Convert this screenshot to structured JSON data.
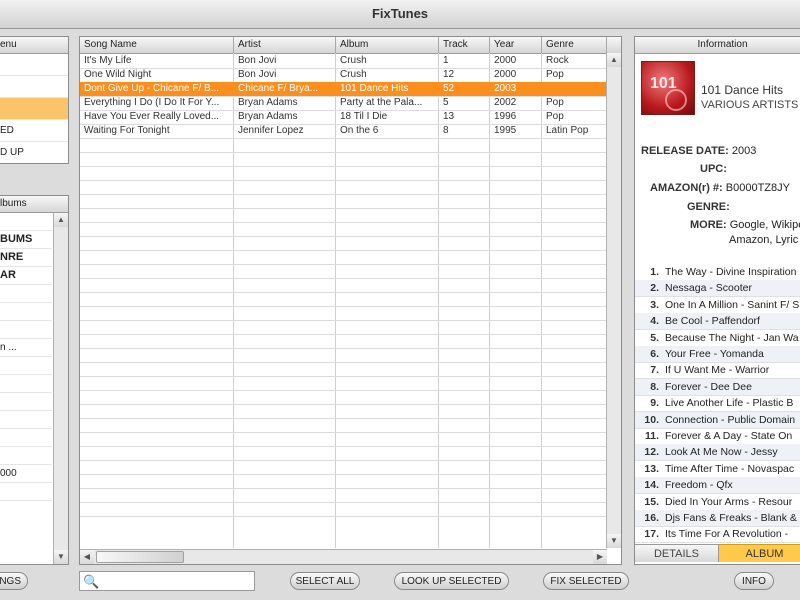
{
  "app": {
    "title": "FixTunes"
  },
  "menu_panel": {
    "header": "enu",
    "items": [
      {
        "label": ""
      },
      {
        "label": ""
      },
      {
        "label": "",
        "selected": true
      },
      {
        "label": "ED"
      },
      {
        "label": "D UP"
      }
    ]
  },
  "albums_panel": {
    "header": "lbums",
    "items": [
      {
        "label": ""
      },
      {
        "label": "BUMS",
        "bold": true
      },
      {
        "label": "NRE",
        "bold": true
      },
      {
        "label": "AR",
        "bold": true
      },
      {
        "label": ""
      },
      {
        "label": ""
      },
      {
        "label": ""
      },
      {
        "label": "n ..."
      },
      {
        "label": ""
      },
      {
        "label": ""
      },
      {
        "label": ""
      },
      {
        "label": ""
      },
      {
        "label": ""
      },
      {
        "label": ""
      },
      {
        "label": "000"
      },
      {
        "label": ""
      }
    ]
  },
  "song_table": {
    "columns": [
      "Song Name",
      "Artist",
      "Album",
      "Track",
      "Year",
      "Genre"
    ],
    "rows": [
      {
        "song": "It's My Life",
        "artist": "Bon Jovi",
        "album": "Crush",
        "track": "1",
        "year": "2000",
        "genre": "Rock"
      },
      {
        "song": "One Wild Night",
        "artist": "Bon Jovi",
        "album": "Crush",
        "track": "12",
        "year": "2000",
        "genre": "Pop"
      },
      {
        "song": "Dont Give Up - Chicane F/ B...",
        "artist": "Chicane F/ Brya...",
        "album": "101 Dance Hits",
        "track": "52",
        "year": "2003",
        "genre": "",
        "selected": true
      },
      {
        "song": "Everything I Do (I Do It For Y...",
        "artist": "Bryan Adams",
        "album": "Party at the Pala...",
        "track": "5",
        "year": "2002",
        "genre": "Pop"
      },
      {
        "song": "Have You Ever Really Loved...",
        "artist": "Bryan Adams",
        "album": "18 Til I Die",
        "track": "13",
        "year": "1996",
        "genre": "Pop"
      },
      {
        "song": "Waiting For Tonight",
        "artist": "Jennifer Lopez",
        "album": "On the 6",
        "track": "8",
        "year": "1995",
        "genre": "Latin Pop"
      }
    ]
  },
  "info_panel": {
    "header": "Information",
    "album_title": "101 Dance Hits",
    "album_artist": "VARIOUS ARTISTS",
    "fields": {
      "release_date_label": "RELEASE DATE:",
      "release_date": "2003",
      "upc_label": "UPC:",
      "upc": "",
      "amazon_label": "AMAZON(r) #:",
      "amazon": "B0000TZ8JY",
      "genre_label": "GENRE:",
      "genre": "",
      "more_label": "MORE:",
      "more_line1": "Google, Wikipe",
      "more_line2": "Amazon, Lyric"
    },
    "tracks": [
      {
        "n": "1.",
        "title": "The Way - Divine Inspiration"
      },
      {
        "n": "2.",
        "title": "Nessaga - Scooter"
      },
      {
        "n": "3.",
        "title": "One In A Million - Sanint F/ S"
      },
      {
        "n": "4.",
        "title": "Be Cool - Paffendorf"
      },
      {
        "n": "5.",
        "title": "Because The Night - Jan Wa"
      },
      {
        "n": "6.",
        "title": "Your Free - Yomanda"
      },
      {
        "n": "7.",
        "title": "If U Want Me - Warrior"
      },
      {
        "n": "8.",
        "title": "Forever - Dee Dee"
      },
      {
        "n": "9.",
        "title": "Live Another Life - Plastic B"
      },
      {
        "n": "10.",
        "title": "Connection - Public Domain"
      },
      {
        "n": "11.",
        "title": "Forever & A Day - State On"
      },
      {
        "n": "12.",
        "title": "Look At Me Now - Jessy"
      },
      {
        "n": "13.",
        "title": "Time After Time - Novaspac"
      },
      {
        "n": "14.",
        "title": "Freedom - Qfx"
      },
      {
        "n": "15.",
        "title": "Died In Your Arms - Resour"
      },
      {
        "n": "16.",
        "title": "Djs Fans & Freaks - Blank &"
      },
      {
        "n": "17.",
        "title": "Its Time For A Revolution - "
      }
    ],
    "tabs": {
      "details": "DETAILS",
      "album": "ALBUM"
    }
  },
  "bottom_bar": {
    "settings": "NGS",
    "search_placeholder": "",
    "select_all": "SELECT ALL",
    "look_up_selected": "LOOK UP SELECTED",
    "fix_selected": "FIX SELECTED",
    "info": "INFO"
  },
  "colors": {
    "selected_row": "#fb8f1e",
    "selected_menu": "#fbc36a",
    "active_tab": "#ffc94a"
  }
}
